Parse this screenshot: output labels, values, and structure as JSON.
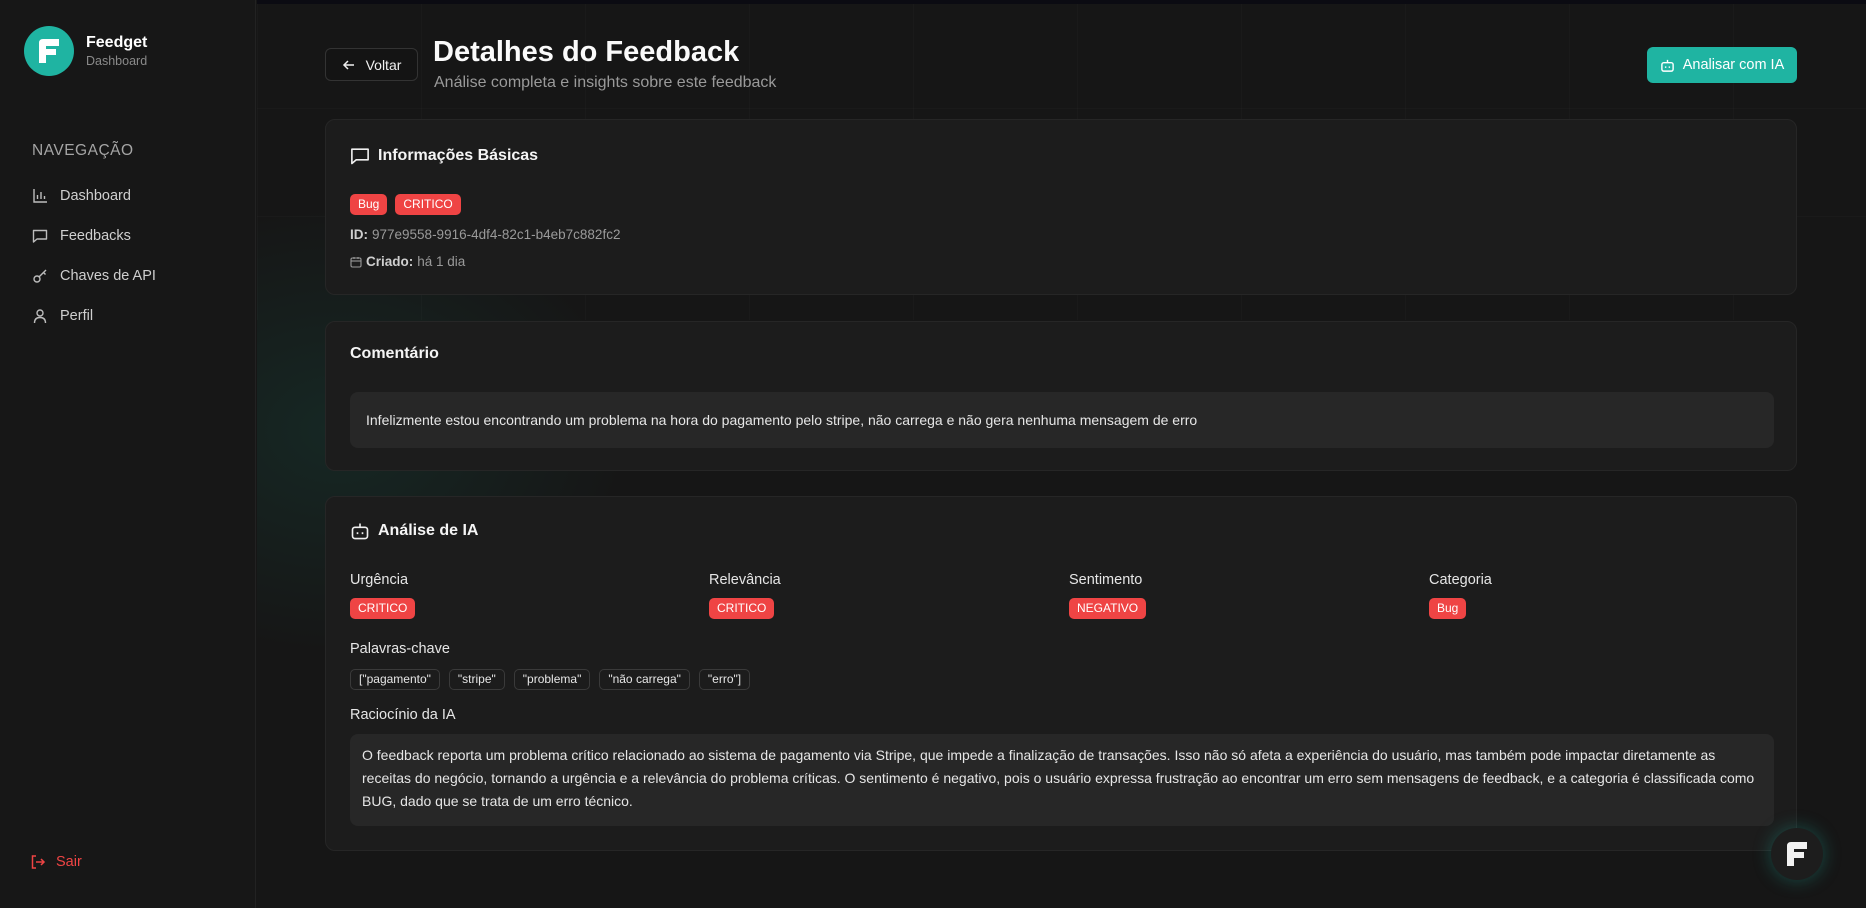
{
  "brand": {
    "name": "Feedget",
    "subtitle": "Dashboard"
  },
  "sidebar": {
    "section_title": "NAVEGAÇÃO",
    "items": [
      {
        "label": "Dashboard",
        "icon": "bar-chart-icon"
      },
      {
        "label": "Feedbacks",
        "icon": "message-square-icon"
      },
      {
        "label": "Chaves de API",
        "icon": "key-icon"
      },
      {
        "label": "Perfil",
        "icon": "user-icon"
      }
    ],
    "logout_label": "Sair"
  },
  "header": {
    "back_label": "Voltar",
    "title": "Detalhes do Feedback",
    "subtitle": "Análise completa e insights sobre este feedback",
    "ai_button_label": "Analisar com IA"
  },
  "basic_info": {
    "title": "Informações Básicas",
    "badges": [
      "Bug",
      "CRITICO"
    ],
    "id_label": "ID:",
    "id_value": "977e9558-9916-4df4-82c1-b4eb7c882fc2",
    "created_label": "Criado:",
    "created_value": "há 1 dia"
  },
  "comment": {
    "title": "Comentário",
    "text": "Infelizmente estou encontrando um problema na hora do pagamento pelo stripe, não carrega e não gera nenhuma mensagem de erro"
  },
  "ai_analysis": {
    "title": "Análise de IA",
    "fields": [
      {
        "label": "Urgência",
        "value": "CRITICO"
      },
      {
        "label": "Relevância",
        "value": "CRITICO"
      },
      {
        "label": "Sentimento",
        "value": "NEGATIVO"
      },
      {
        "label": "Categoria",
        "value": "Bug"
      }
    ],
    "keywords_label": "Palavras-chave",
    "keywords": [
      "[\"pagamento\"",
      "\"stripe\"",
      "\"problema\"",
      "\"não carrega\"",
      "\"erro\"]"
    ],
    "reasoning_label": "Raciocínio da IA",
    "reasoning_text": "O feedback reporta um problema crítico relacionado ao sistema de pagamento via Stripe, que impede a finalização de transações. Isso não só afeta a experiência do usuário, mas também pode impactar diretamente as receitas do negócio, tornando a urgência e a relevância do problema críticas. O sentimento é negativo, pois o usuário expressa frustração ao encontrar um erro sem mensagens de feedback, e a categoria é classificada como BUG, dado que se trata de um erro técnico."
  },
  "colors": {
    "accent": "#1fb4a2",
    "danger": "#ef4444",
    "background": "#161616",
    "card": "#1c1c1c"
  }
}
